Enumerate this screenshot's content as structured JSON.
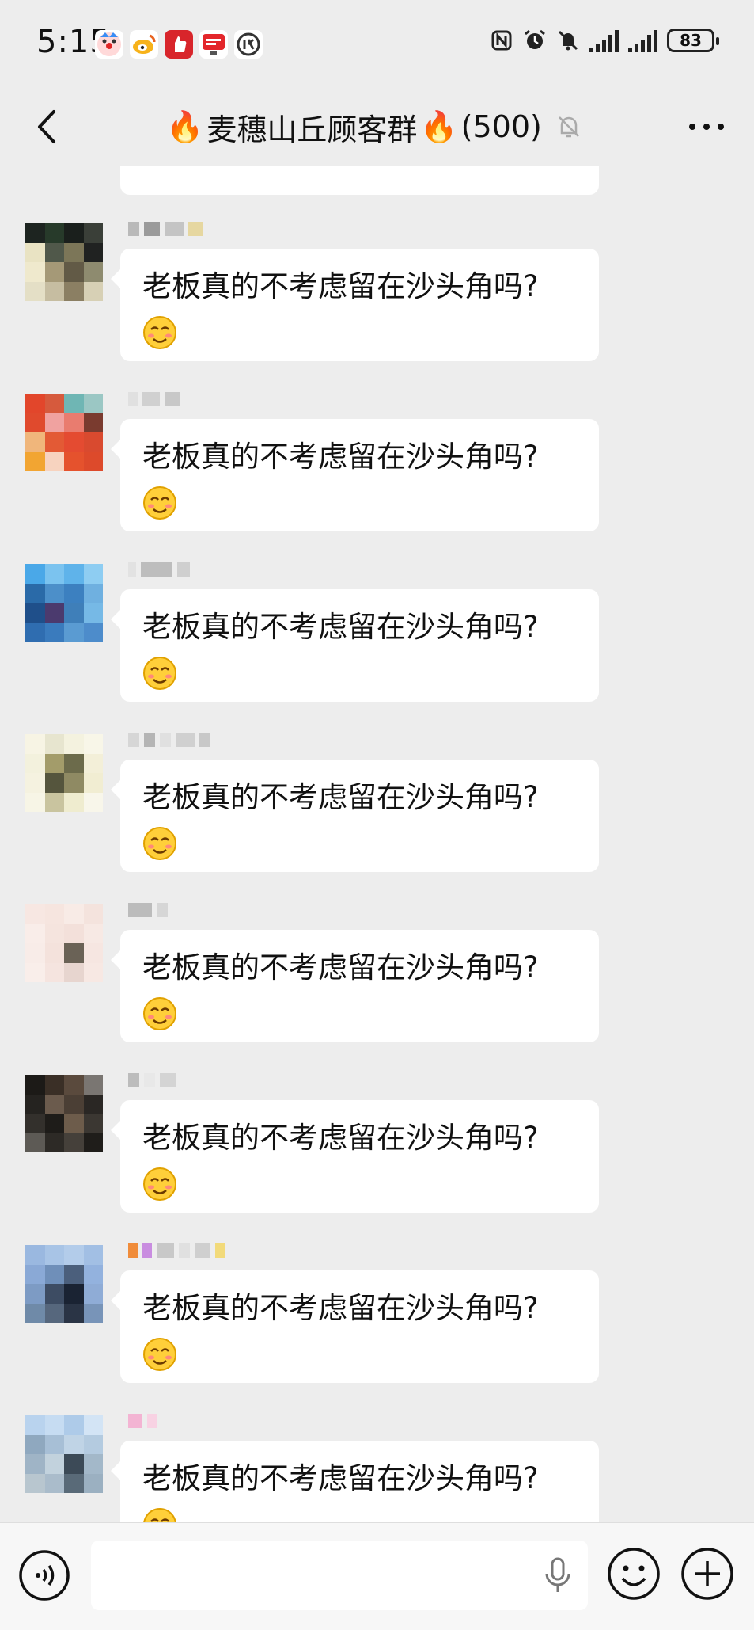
{
  "status": {
    "time": "5:15",
    "battery": "83"
  },
  "header": {
    "title_prefix": "🔥",
    "title_main": "麦穗山丘顾客群",
    "title_suffix": "🔥",
    "member_count": "(500)"
  },
  "messages": [
    {
      "text": "老板真的不考虑留在沙头角吗?"
    },
    {
      "text": "老板真的不考虑留在沙头角吗?"
    },
    {
      "text": "老板真的不考虑留在沙头角吗?"
    },
    {
      "text": "老板真的不考虑留在沙头角吗?"
    },
    {
      "text": "老板真的不考虑留在沙头角吗?"
    },
    {
      "text": "老板真的不考虑留在沙头角吗?"
    },
    {
      "text": "老板真的不考虑留在沙头角吗?"
    },
    {
      "text": "老板真的不考虑留在沙头角吗?"
    }
  ],
  "colors": {
    "chat_background": "#ededed",
    "bubble": "#ffffff",
    "fire": "#f26b1d"
  }
}
